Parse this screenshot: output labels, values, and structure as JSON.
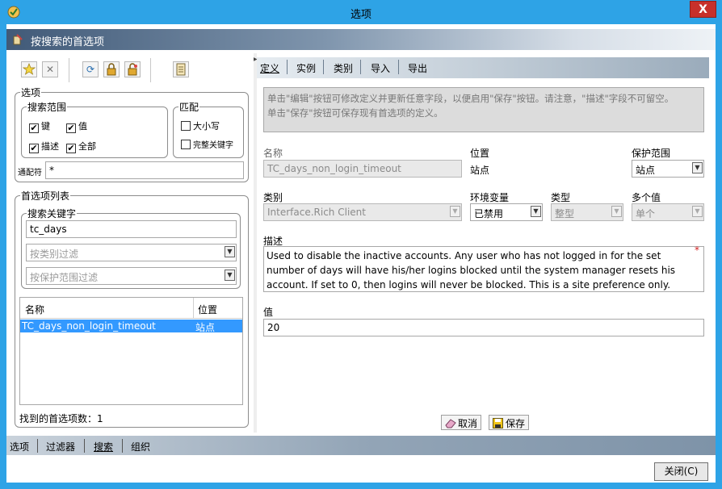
{
  "window": {
    "title": "选项",
    "close_glyph": "X"
  },
  "header": {
    "title": "按搜索的首选项"
  },
  "toolbar": {
    "icons": [
      "star-add-icon",
      "delete-icon",
      "refresh-icon",
      "lock-icon",
      "unlock-icon",
      "document-icon"
    ],
    "delete_glyph": "✕",
    "refresh_glyph": "⟳"
  },
  "options": {
    "legend": "选项",
    "search_scope": {
      "legend": "搜索范围",
      "key": {
        "label": "键",
        "checked": true
      },
      "value": {
        "label": "值",
        "checked": true
      },
      "description": {
        "label": "描述",
        "checked": true
      },
      "all": {
        "label": "全部",
        "checked": true
      }
    },
    "match": {
      "legend": "匹配",
      "case": {
        "label": "大小写",
        "checked": false
      },
      "whole_keyword": {
        "label": "完整关键字",
        "checked": false
      }
    },
    "wildcard_label": "通配符",
    "wildcard_value": "*"
  },
  "pref_list": {
    "legend": "首选项列表",
    "search_keyword_legend": "搜索关键字",
    "search_keyword_value": "tc_days",
    "filter_category_placeholder": "按类别过滤",
    "filter_scope_placeholder": "按保护范围过滤",
    "columns": [
      "名称",
      "位置"
    ],
    "rows": [
      {
        "name": "TC_days_non_login_timeout",
        "location": "站点",
        "selected": true
      }
    ],
    "found_label": "找到的首选项数：1"
  },
  "right": {
    "tabs": [
      "定义",
      "实例",
      "类别",
      "导入",
      "导出"
    ],
    "info_lines": [
      "单击\"编辑\"按钮可修改定义并更新任意字段，以便启用\"保存\"按钮。请注意，\"描述\"字段不可留空。",
      "单击\"保存\"按钮可保存现有首选项的定义。"
    ],
    "name_label": "名称",
    "name_value": "TC_days_non_login_timeout",
    "location_label": "位置",
    "location_value": "站点",
    "protection_label": "保护范围",
    "protection_value": "站点",
    "category_label": "类别",
    "category_value": "Interface.Rich Client",
    "env_label": "环境变量",
    "env_value": "已禁用",
    "type_label": "类型",
    "type_value": "整型",
    "multi_label": "多个值",
    "multi_value": "单个",
    "desc_label": "描述",
    "desc_value": "Used to disable the inactive accounts. Any user who has not logged in for the set number of days will have his/her logins blocked until the system manager resets his account. If set to 0, then logins will never be blocked. This is a site preference only.",
    "required_mark": "*",
    "value_label": "值",
    "value_value": "20",
    "cancel_label": "取消",
    "save_label": "保存"
  },
  "bottom_nav": {
    "tabs": [
      "选项",
      "过滤器",
      "搜索",
      "组织"
    ],
    "active": "搜索"
  },
  "footer": {
    "close_label": "关闭(C)"
  },
  "colors": {
    "titlebar": "#2ea3e6",
    "close_button": "#c7302b",
    "selected_row": "#3399ff"
  },
  "dropdown_glyph": "▼",
  "check_glyph": "✔"
}
